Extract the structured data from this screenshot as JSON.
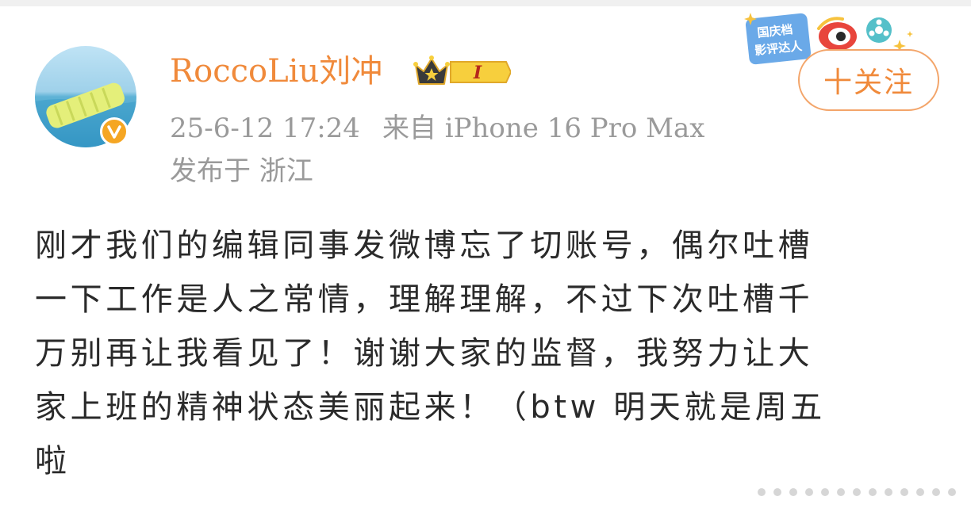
{
  "user": {
    "name": "RoccoLiu刘冲",
    "level_badge": "I",
    "verified_icon": "v-verified-icon"
  },
  "meta": {
    "timestamp": "25-6-12 17:24",
    "source": "来自 iPhone 16 Pro Max",
    "location": "发布于 浙江"
  },
  "event_badge": {
    "line1": "国庆档",
    "line2": "影评达人"
  },
  "follow_button": {
    "label": "十关注"
  },
  "post": {
    "text": "刚才我们的编辑同事发微博忘了切账号，偶尔吐槽\n一下工作是人之常情，理解理解，不过下次吐槽千\n万别再让我看见了！谢谢大家的监督，我努力让大\n家上班的精神状态美丽起来！（btw 明天就是周五\n啦"
  },
  "colors": {
    "accent": "#f08a3b",
    "meta_text": "#9a9a9a",
    "body_text": "#2a2a2a"
  }
}
